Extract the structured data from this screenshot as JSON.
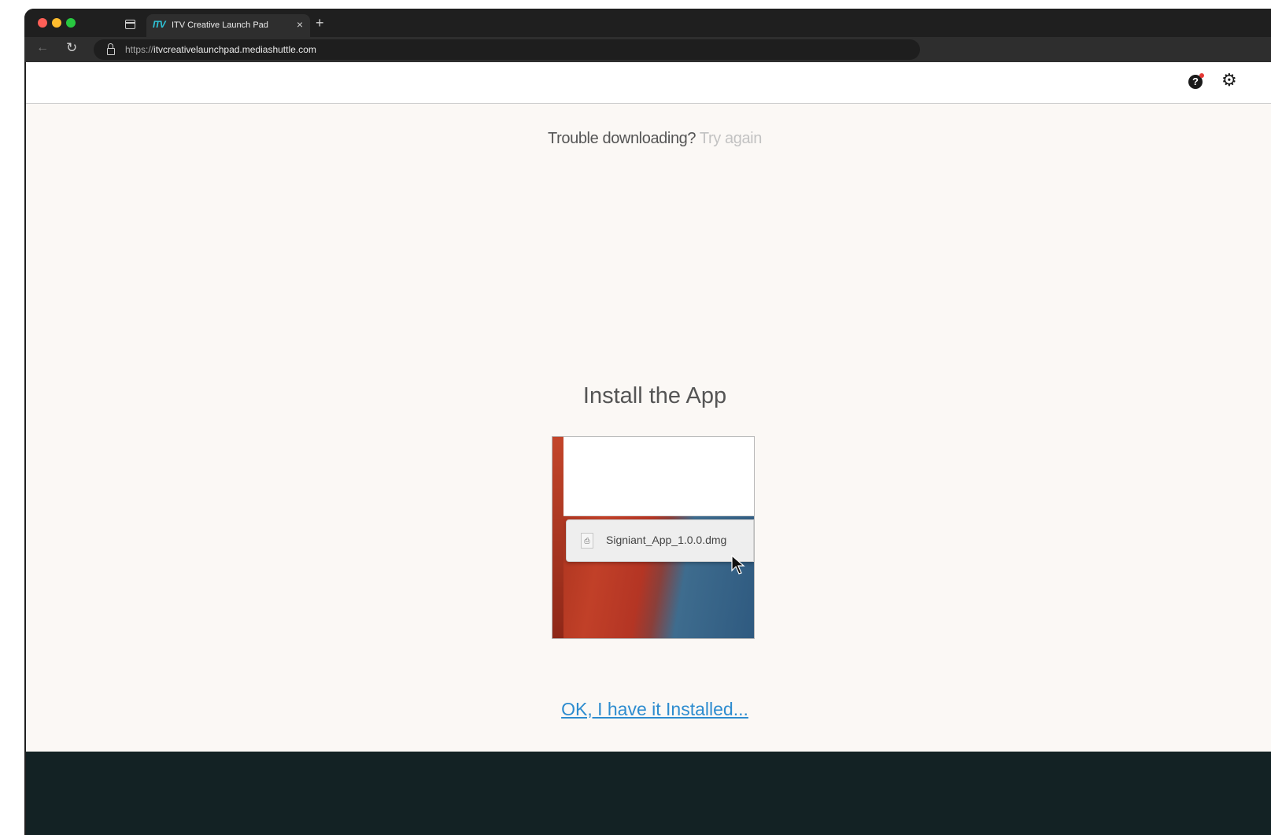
{
  "browser": {
    "tab": {
      "favicon_text": "ITV",
      "title": "ITV Creative Launch Pad",
      "close_glyph": "×"
    },
    "new_tab_glyph": "+",
    "url": {
      "protocol": "https://",
      "host": "itvcreativelaunchpad.mediashuttle.com"
    }
  },
  "header": {
    "help_glyph": "?",
    "settings_glyph": "⚙",
    "notification_color": "#e53935"
  },
  "main": {
    "trouble_text": "Trouble downloading?",
    "try_again_label": "Try again",
    "install_title": "Install the App",
    "preview": {
      "file_icon_glyph": "⎙",
      "file_name": "Signiant_App_1.0.0.dmg"
    },
    "installed_link": "OK, I have it Installed..."
  },
  "colors": {
    "link": "#2d8ccf",
    "footer_bg": "#132224",
    "page_bg": "#fbf8f5"
  }
}
